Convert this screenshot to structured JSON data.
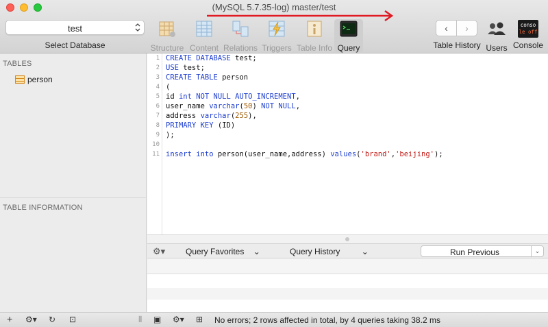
{
  "window": {
    "title": "(MySQL 5.7.35-log) master/test"
  },
  "toolbar": {
    "database_value": "test",
    "database_label": "Select Database",
    "tools": [
      {
        "id": "structure",
        "label": "Structure"
      },
      {
        "id": "content",
        "label": "Content"
      },
      {
        "id": "relations",
        "label": "Relations"
      },
      {
        "id": "triggers",
        "label": "Triggers"
      },
      {
        "id": "tableinfo",
        "label": "Table Info"
      },
      {
        "id": "query",
        "label": "Query"
      }
    ],
    "back_glyph": "‹",
    "forward_glyph": "›",
    "table_history_label": "Table History",
    "users_label": "Users",
    "console_label": "Console",
    "console_icon_text_top": "conso",
    "console_icon_text_bottom": "le off"
  },
  "sidebar": {
    "tables_heading": "TABLES",
    "tables": [
      {
        "name": "person"
      }
    ],
    "table_info_heading": "TABLE INFORMATION"
  },
  "editor": {
    "line_numbers": [
      "1",
      "2",
      "3",
      "4",
      "5",
      "6",
      "7",
      "8",
      "9",
      "10",
      "11"
    ]
  },
  "query_bar": {
    "gear_glyph": "⚙▾",
    "favorites_label": "Query Favorites",
    "history_label": "Query History",
    "dropdown_glyph": "⌄",
    "run_label": "Run Previous",
    "run_split_glyph": "⌄"
  },
  "status_bar": {
    "add_glyph": "+",
    "gear_glyph": "⚙▾",
    "refresh_glyph": "↻",
    "filter_glyph": "⊡",
    "split_glyph": "⦀",
    "image_glyph": "▣",
    "gear2_glyph": "⚙▾",
    "console_glyph": "⊞",
    "message": "No errors; 2 rows affected in total, by 4 queries taking 38.2 ms"
  }
}
